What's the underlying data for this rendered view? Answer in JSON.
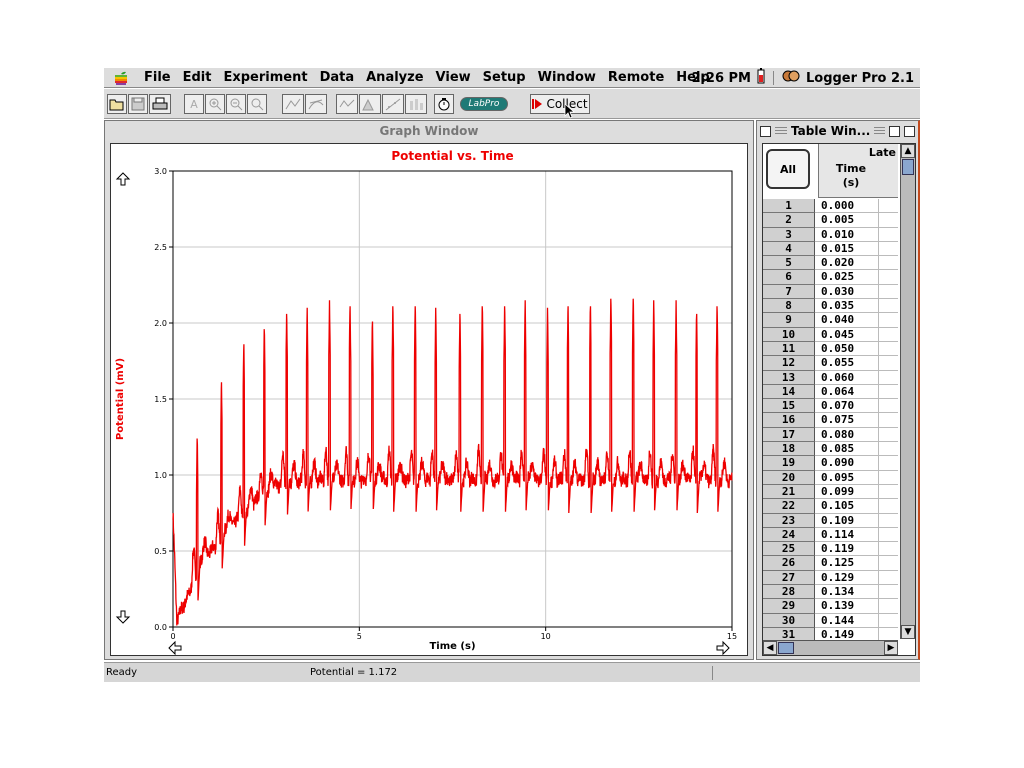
{
  "menubar": {
    "items": [
      "File",
      "Edit",
      "Experiment",
      "Data",
      "Analyze",
      "View",
      "Setup",
      "Window",
      "Remote",
      "Help"
    ],
    "clock": "2:26 PM",
    "app_name": "Logger Pro 2.1"
  },
  "toolbar": {
    "labpro_label": "LabPro",
    "collect_label": "Collect"
  },
  "graph_window": {
    "title": "Graph Window"
  },
  "chart_data": {
    "type": "line",
    "title": "Potential vs. Time",
    "xlabel": "Time (s)",
    "ylabel": "Potential (mV)",
    "xlim": [
      0,
      15
    ],
    "ylim": [
      0,
      3
    ],
    "x_ticks": [
      "0",
      "5",
      "10",
      "15"
    ],
    "y_ticks": [
      "0.0",
      "0.5",
      "1.0",
      "1.5",
      "2.0",
      "2.5",
      "3.0"
    ],
    "grid": true,
    "color": "#ee0000",
    "series": [
      {
        "x": [
          0,
          0.1,
          0.2,
          0.4,
          0.6,
          0.8,
          1.0,
          1.2,
          1.3,
          1.6,
          1.9,
          2.3,
          2.7,
          3.0,
          3.5,
          4.0,
          4.5,
          5.0,
          6.0,
          7.0,
          8.0,
          9.0,
          10.0,
          11.0,
          12.0,
          13.0,
          14.0,
          15.0
        ],
        "y": [
          0.75,
          0.05,
          0.1,
          0.2,
          0.35,
          0.45,
          0.5,
          0.55,
          0.6,
          0.68,
          0.75,
          0.85,
          0.92,
          0.95,
          0.96,
          0.97,
          0.97,
          0.97,
          0.97,
          0.97,
          0.97,
          0.97,
          0.97,
          0.97,
          0.97,
          0.97,
          0.97,
          0.97
        ]
      }
    ],
    "spikes": {
      "times": [
        0.65,
        1.3,
        1.9,
        2.45,
        3.05,
        3.6,
        4.2,
        4.75,
        5.35,
        5.9,
        6.5,
        7.05,
        7.7,
        8.3,
        8.9,
        9.45,
        10.05,
        10.6,
        11.2,
        11.75,
        12.35,
        12.9,
        13.5,
        14.05,
        14.6
      ],
      "peaks": [
        1.28,
        1.65,
        1.9,
        2.0,
        2.1,
        2.1,
        2.15,
        2.15,
        2.05,
        2.15,
        2.15,
        2.1,
        2.1,
        2.15,
        2.15,
        2.15,
        2.1,
        2.15,
        2.15,
        2.2,
        2.2,
        2.15,
        2.15,
        2.1,
        2.15
      ]
    }
  },
  "table_window": {
    "title": "Table Win...",
    "all_label": "All",
    "run_label": "Late",
    "column_header_line1": "Time",
    "column_header_line2": "(s)",
    "rows": [
      [
        "1",
        "0.000"
      ],
      [
        "2",
        "0.005"
      ],
      [
        "3",
        "0.010"
      ],
      [
        "4",
        "0.015"
      ],
      [
        "5",
        "0.020"
      ],
      [
        "6",
        "0.025"
      ],
      [
        "7",
        "0.030"
      ],
      [
        "8",
        "0.035"
      ],
      [
        "9",
        "0.040"
      ],
      [
        "10",
        "0.045"
      ],
      [
        "11",
        "0.050"
      ],
      [
        "12",
        "0.055"
      ],
      [
        "13",
        "0.060"
      ],
      [
        "14",
        "0.064"
      ],
      [
        "15",
        "0.070"
      ],
      [
        "16",
        "0.075"
      ],
      [
        "17",
        "0.080"
      ],
      [
        "18",
        "0.085"
      ],
      [
        "19",
        "0.090"
      ],
      [
        "20",
        "0.095"
      ],
      [
        "21",
        "0.099"
      ],
      [
        "22",
        "0.105"
      ],
      [
        "23",
        "0.109"
      ],
      [
        "24",
        "0.114"
      ],
      [
        "25",
        "0.119"
      ],
      [
        "26",
        "0.125"
      ],
      [
        "27",
        "0.129"
      ],
      [
        "28",
        "0.134"
      ],
      [
        "29",
        "0.139"
      ],
      [
        "30",
        "0.144"
      ],
      [
        "31",
        "0.149"
      ]
    ]
  },
  "statusbar": {
    "status": "Ready",
    "readout": "Potential = 1.172"
  }
}
